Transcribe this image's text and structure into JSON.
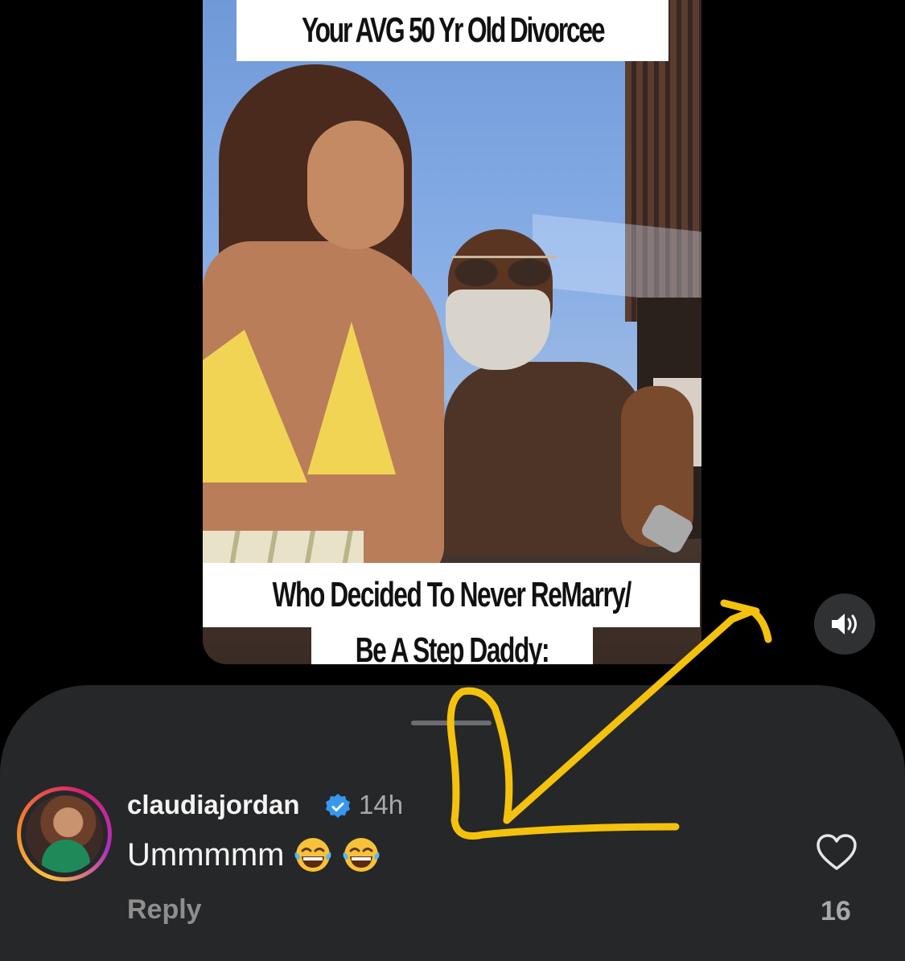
{
  "video": {
    "caption_top": "Your AVG 50 Yr Old Divorcee",
    "caption_bottom_line1": "Who Decided To Never ReMarry/",
    "caption_bottom_line2": "Be A Step Daddy:",
    "sound_icon": "speaker-on-icon"
  },
  "comment": {
    "username": "claudiajordan",
    "verified_icon": "verified-badge-icon",
    "time": "14h",
    "text": "Ummmmm",
    "emojis": [
      "face-with-tears-of-joy",
      "face-with-tears-of-joy"
    ],
    "reply_label": "Reply",
    "like_icon": "heart-outline-icon",
    "like_count": "16"
  },
  "annotation": {
    "color": "#f4c20d",
    "shape": "hand-drawn-arrow-pointing-down-left"
  },
  "colors": {
    "sheet_bg": "#262729",
    "verified_blue": "#3897f0"
  }
}
